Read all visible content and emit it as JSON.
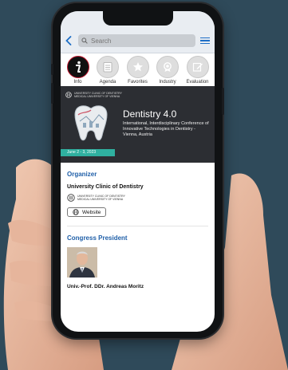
{
  "navbar": {
    "search_placeholder": "Search"
  },
  "tabs": [
    {
      "label": "Info",
      "icon": "info-icon"
    },
    {
      "label": "Agenda",
      "icon": "agenda-icon"
    },
    {
      "label": "Favorites",
      "icon": "star-icon"
    },
    {
      "label": "Industry",
      "icon": "badge-icon"
    },
    {
      "label": "Evaluation",
      "icon": "edit-icon"
    }
  ],
  "banner": {
    "logo_line1": "UNIVERSITY CLINIC OF DENTISTRY",
    "logo_line2": "MEDICAL UNIVERSITY OF VIENNA",
    "title": "Dentistry 4.0",
    "subtitle": "International, Interdisciplinary Conference of Innovative Technologies in Dentistry - Vienna, Austria",
    "dates": "June 2 - 3, 2023"
  },
  "organizer": {
    "heading": "Organizer",
    "name": "University Clinic of Dentistry",
    "logo_line1": "UNIVERSITY CLINIC OF DENTISTRY",
    "logo_line2": "MEDICAL UNIVERSITY OF VIENNA",
    "website_label": "Website"
  },
  "president": {
    "heading": "Congress President",
    "name": "Univ.-Prof. DDr. Andreas Moritz"
  },
  "colors": {
    "accent": "#1f5fa8",
    "active_ring": "#c0172f",
    "date_strip": "#2fb0a0"
  }
}
